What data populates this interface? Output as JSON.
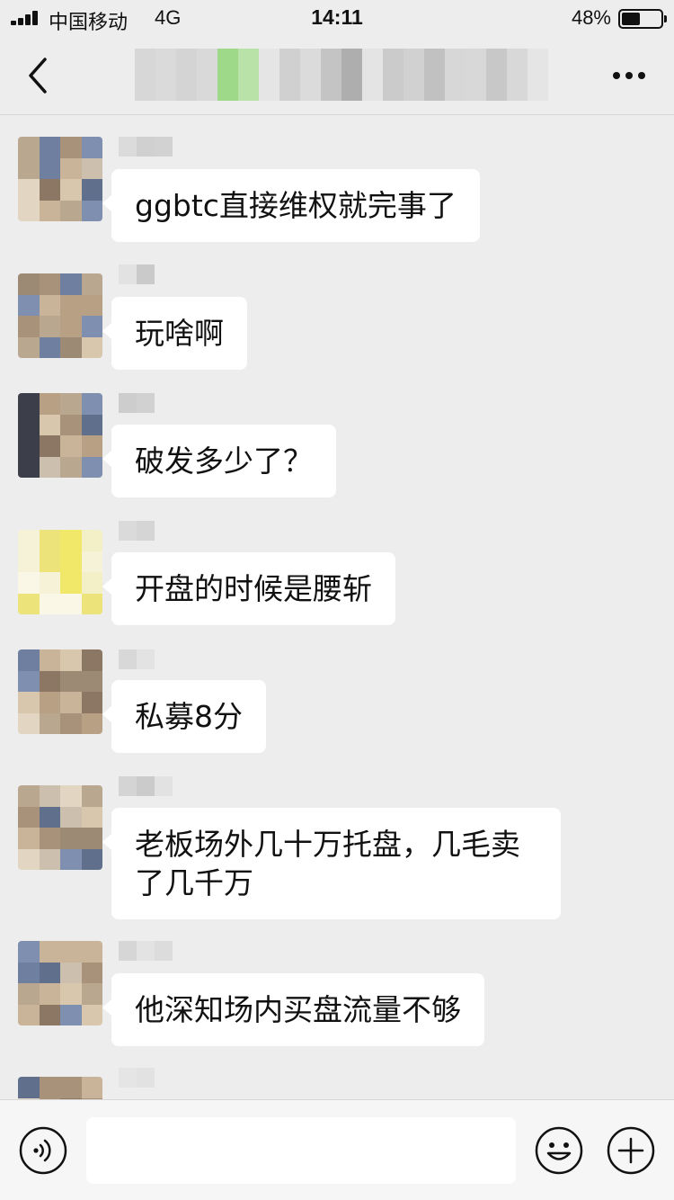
{
  "status_bar": {
    "carrier": "中国移动",
    "network": "4G",
    "time": "14:11",
    "battery_percent": "48%",
    "battery_level": 0.48
  },
  "nav": {
    "back_icon": "chevron-left-icon",
    "more_icon": "ellipsis-icon",
    "title": ""
  },
  "messages": [
    {
      "text": "ggbtc直接维权就完事了"
    },
    {
      "text": "玩啥啊"
    },
    {
      "text": "破发多少了？"
    },
    {
      "text": "开盘的时候是腰斩"
    },
    {
      "text": "私募8分"
    },
    {
      "text": "老板场外几十万托盘，几毛卖了几千万"
    },
    {
      "text": "他深知场内买盘流量不够"
    },
    {
      "text": ""
    }
  ],
  "input_bar": {
    "voice_icon": "voice-icon",
    "emoji_icon": "smiley-icon",
    "add_icon": "plus-circle-icon",
    "placeholder": ""
  },
  "colors": {
    "background": "#ededed",
    "bubble": "#ffffff",
    "input_bar": "#f6f6f6",
    "text": "#111111"
  }
}
